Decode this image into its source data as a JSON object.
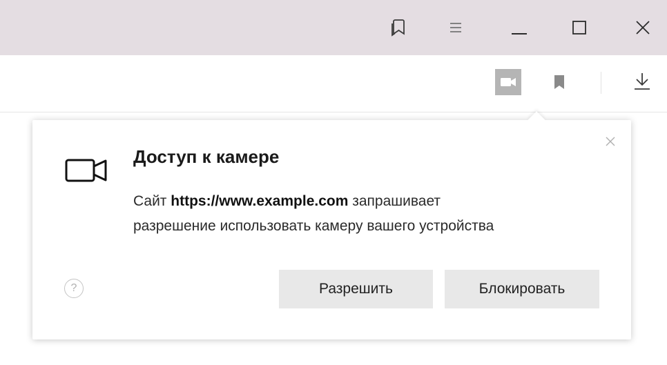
{
  "titlebar": {
    "icons": [
      "pages-icon",
      "menu-icon",
      "minimize-icon",
      "maximize-icon",
      "close-icon"
    ],
    "color": "#e4dde2"
  },
  "toolbar": {
    "icons": [
      "camera-icon",
      "bookmark-icon",
      "download-icon"
    ],
    "camera_active_color": "#b5b5b5"
  },
  "popup": {
    "title": "Доступ к камере",
    "message_prefix": "Сайт",
    "site_url": "https://www.example.com",
    "message_suffix_line1": "запрашивает",
    "message_line2": "разрешение использовать камеру вашего устройства",
    "help_symbol": "?",
    "allow_label": "Разрешить",
    "block_label": "Блокировать",
    "button_color": "#e8e8e8"
  }
}
